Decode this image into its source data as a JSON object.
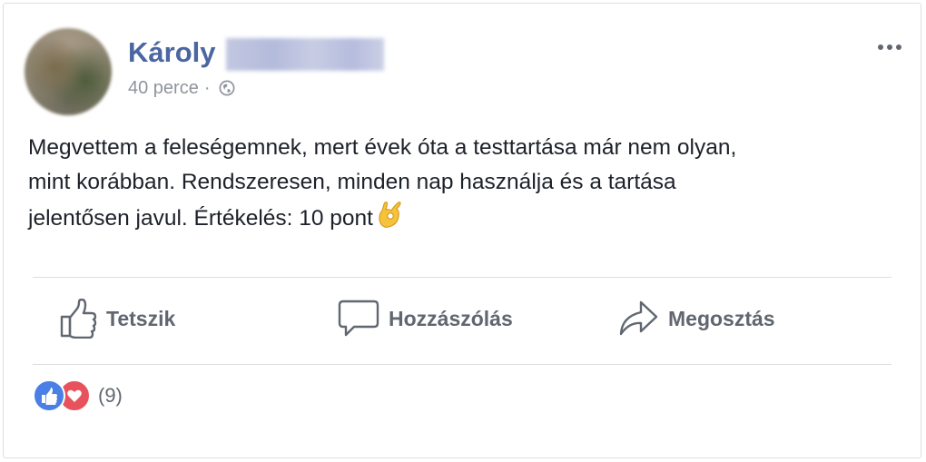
{
  "post": {
    "author_first_name": "Károly",
    "time": "40 perce",
    "separator": "·",
    "privacy_icon": "globe-icon",
    "options_icon": "more-options-icon",
    "text_line_1": "Megvettem a feleségemnek, mert évek óta a testtartása már nem olyan,",
    "text_line_2": "mint korábban. Rendszeresen, minden nap használja és a tartása",
    "text_line_3": "jelentősen javul. Értékelés: 10 pont",
    "text_emoji": "ok-hand-emoji"
  },
  "actions": {
    "like": {
      "label": "Tetszik",
      "icon": "thumbs-up-icon"
    },
    "comment": {
      "label": "Hozzászólás",
      "icon": "comment-bubble-icon"
    },
    "share": {
      "label": "Megosztás",
      "icon": "share-arrow-icon"
    }
  },
  "reactions": {
    "types": [
      "like",
      "love"
    ],
    "count": "(9)",
    "colors": {
      "like": "#4a7fe5",
      "love": "#e8525d"
    }
  },
  "colors": {
    "author": "#4b67a1",
    "meta": "#90949c",
    "text": "#1d2129",
    "action": "#606770",
    "divider": "#dadde1"
  }
}
